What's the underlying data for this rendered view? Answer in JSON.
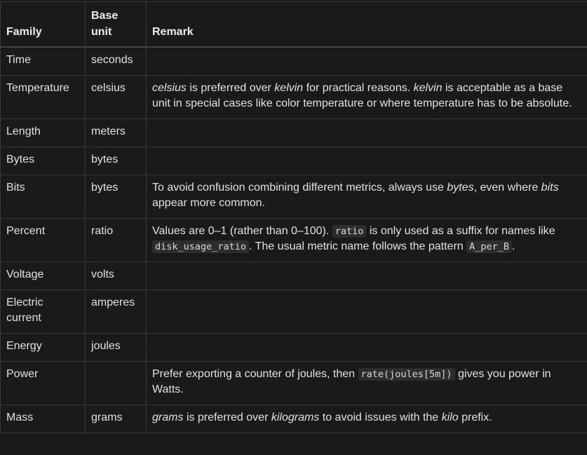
{
  "headers": {
    "family": "Family",
    "base_unit_line1": "Base",
    "base_unit_line2": "unit",
    "remark": "Remark"
  },
  "rows": [
    {
      "family": "Time",
      "unit": "seconds"
    },
    {
      "family": "Temperature",
      "unit": "celsius",
      "remark": {
        "w1": "celsius",
        "t1": " is preferred over ",
        "w2": "kelvin",
        "t2": " for practical reasons. ",
        "w3": "kelvin",
        "t3": " is acceptable as a base unit in special cases like color temperature or where temperature has to be absolute."
      }
    },
    {
      "family": "Length",
      "unit": "meters"
    },
    {
      "family": "Bytes",
      "unit": "bytes"
    },
    {
      "family": "Bits",
      "unit": "bytes",
      "remark": {
        "t1": "To avoid confusion combining different metrics, always use ",
        "w1": "bytes",
        "t2": ", even where ",
        "w2": "bits",
        "t3": " appear more common."
      }
    },
    {
      "family": "Percent",
      "unit": "ratio",
      "remark": {
        "t1": "Values are 0–1 (rather than 0–100). ",
        "c1": "ratio",
        "t2": " is only used as a suffix for names like ",
        "c2": "disk_usage_ratio",
        "t3": ". The usual metric name follows the pattern ",
        "c3": "A_per_B",
        "t4": "."
      }
    },
    {
      "family": "Voltage",
      "unit": "volts"
    },
    {
      "family_line1": "Electric",
      "family_line2": "current",
      "unit": "amperes"
    },
    {
      "family": "Energy",
      "unit": "joules"
    },
    {
      "family": "Power",
      "unit": "",
      "remark": {
        "t1": "Prefer exporting a counter of joules, then ",
        "c1": "rate(joules[5m])",
        "t2": " gives you power in Watts."
      }
    },
    {
      "family": "Mass",
      "unit": "grams",
      "remark": {
        "w1": "grams",
        "t1": " is preferred over ",
        "w2": "kilograms",
        "t2": " to avoid issues with the ",
        "w3": "kilo",
        "t3": " prefix."
      }
    }
  ]
}
